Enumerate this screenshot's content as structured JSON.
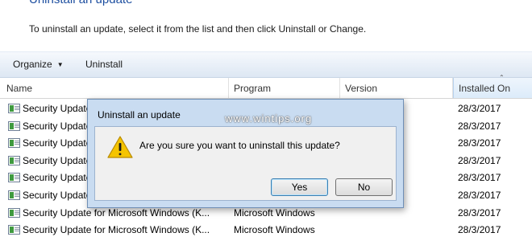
{
  "page": {
    "title": "Uninstall an update",
    "instructions": "To uninstall an update, select it from the list and then click Uninstall or Change."
  },
  "toolbar": {
    "organize_label": "Organize",
    "uninstall_label": "Uninstall"
  },
  "table": {
    "columns": [
      "Name",
      "Program",
      "Version",
      "Installed On"
    ],
    "rows": [
      {
        "name": "Security Update for Microsoft Windows (K...",
        "program": "",
        "installed": "28/3/2017"
      },
      {
        "name": "Security Update for Microsoft Windows (K...",
        "program": "",
        "installed": "28/3/2017"
      },
      {
        "name": "Security Update for Microsoft Windows (K...",
        "program": "",
        "installed": "28/3/2017"
      },
      {
        "name": "Security Update for Microsoft Windows (K...",
        "program": "",
        "installed": "28/3/2017"
      },
      {
        "name": "Security Update for Microsoft Windows (K...",
        "program": "",
        "installed": "28/3/2017"
      },
      {
        "name": "Security Update for Microsoft Windows (K...",
        "program": "",
        "installed": "28/3/2017"
      },
      {
        "name": "Security Update for Microsoft Windows (K...",
        "program": "Microsoft Windows",
        "installed": "28/3/2017"
      },
      {
        "name": "Security Update for Microsoft Windows (K...",
        "program": "Microsoft Windows",
        "installed": "28/3/2017"
      }
    ]
  },
  "dialog": {
    "title": "Uninstall an update",
    "message": "Are you sure you want to uninstall this update?",
    "yes_label": "Yes",
    "no_label": "No",
    "icon": "warning-icon"
  },
  "watermark": "www.wintips.org",
  "colors": {
    "title_blue": "#1e4fa0",
    "dialog_frame": "#c9dcf1",
    "warning_yellow": "#f5c400"
  }
}
